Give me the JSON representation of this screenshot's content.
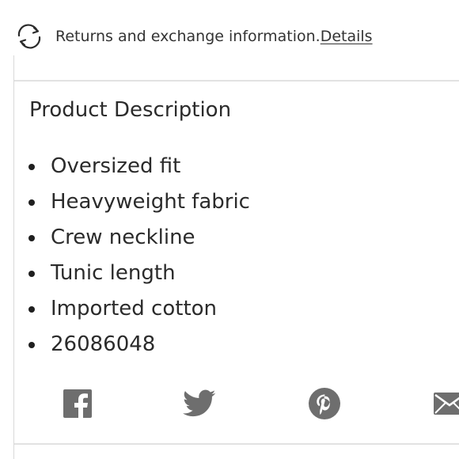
{
  "returns": {
    "text": "Returns and exchange information.",
    "link_label": "Details",
    "icon": "refresh-arrows-icon"
  },
  "product_description": {
    "title": "Product Description",
    "items": [
      "Oversized fit",
      "Heavyweight fabric",
      "Crew neckline",
      "Tunic length",
      "Imported cotton",
      "26086048"
    ]
  },
  "social": {
    "icons": [
      "facebook-icon",
      "twitter-icon",
      "pinterest-icon",
      "email-icon"
    ],
    "color": "#6e6e6e"
  },
  "colors": {
    "text": "#2b2b2b",
    "divider": "#e2e2e2",
    "icon": "#6e6e6e"
  }
}
